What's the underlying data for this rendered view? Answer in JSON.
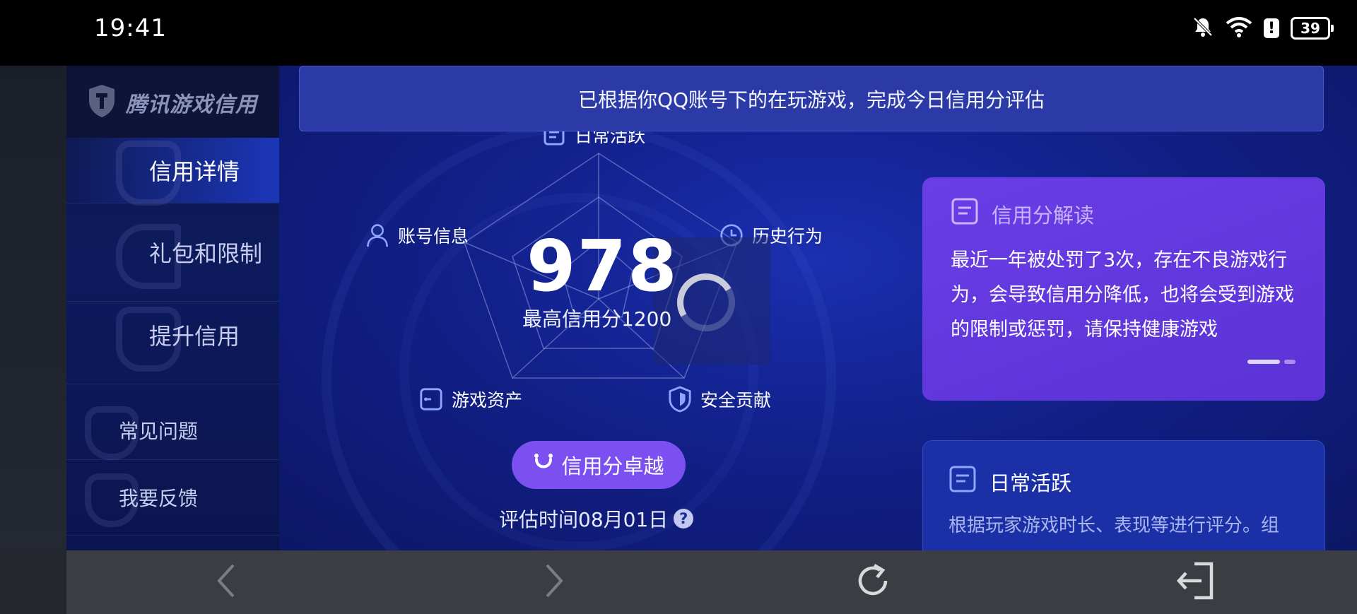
{
  "status_bar": {
    "time": "19:41",
    "alert_glyph": "!",
    "battery_level": "39",
    "icons": [
      "bell-muted-icon",
      "wifi-icon",
      "alert-icon",
      "battery-icon"
    ]
  },
  "sidebar": {
    "logo_text": "腾讯游戏信用",
    "items": [
      {
        "label": "信用详情",
        "active": true
      },
      {
        "label": "礼包和限制",
        "active": false
      },
      {
        "label": "提升信用",
        "active": false
      },
      {
        "label": "常见问题",
        "active": false
      },
      {
        "label": "我要反馈",
        "active": false
      }
    ]
  },
  "banner": {
    "text": "已根据你QQ账号下的在玩游戏，完成今日信用分评估"
  },
  "radar": {
    "axes": [
      {
        "label": "日常活跃",
        "icon": "document-icon"
      },
      {
        "label": "历史行为",
        "icon": "clock-icon"
      },
      {
        "label": "安全贡献",
        "icon": "shield-icon"
      },
      {
        "label": "游戏资产",
        "icon": "wallet-icon"
      },
      {
        "label": "账号信息",
        "icon": "user-icon"
      }
    ],
    "score": "978",
    "max_score_label": "最高信用分1200",
    "level_button": "信用分卓越",
    "eval_time": "评估时间08月01日",
    "help_glyph": "?"
  },
  "card_interpretation": {
    "title": "信用分解读",
    "body": "最近一年被处罚了3次，存在不良游戏行为，会导致信用分降低，也将会受到游戏的限制或惩罚，请保持健康游戏"
  },
  "card_daily": {
    "title": "日常活跃",
    "body": "根据玩家游戏时长、表现等进行评分。组"
  },
  "bottom_bar": {
    "buttons": [
      "back-icon",
      "forward-icon",
      "refresh-icon",
      "exit-icon"
    ]
  },
  "colors": {
    "accent_purple": "#7b4ff0",
    "main_blue": "#12208a",
    "card_purple": "#5b33d6"
  }
}
